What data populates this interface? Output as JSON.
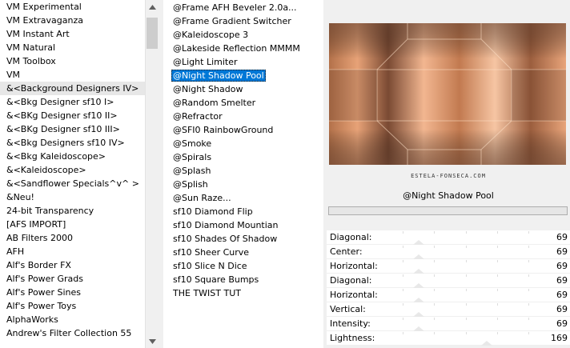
{
  "categories": [
    "VM Experimental",
    "VM Extravaganza",
    "VM Instant Art",
    "VM Natural",
    "VM Toolbox",
    "VM",
    "&<Background Designers IV>",
    "&<Bkg Designer sf10 I>",
    "&<BKg Designer sf10 II>",
    "&<BKg Designer sf10 III>",
    "&<Bkg Designers sf10 IV>",
    "&<Bkg Kaleidoscope>",
    "&<Kaleidoscope>",
    "&<Sandflower Specials^v^ >",
    "&Neu!",
    "24-bit Transparency",
    "[AFS IMPORT]",
    "AB Filters 2000",
    "AFH",
    "Alf's Border FX",
    "Alf's Power Grads",
    "Alf's Power Sines",
    "Alf's Power Toys",
    "AlphaWorks",
    "Andrew's Filter Collection 55"
  ],
  "selected_category_index": 6,
  "filters": [
    "@Frame AFH Beveler 2.0a...",
    "@Frame Gradient Switcher",
    "@Kaleidoscope 3",
    "@Lakeside Reflection MMMM",
    "@Light Limiter",
    "@Night Shadow Pool",
    "@Night Shadow",
    "@Random Smelter",
    "@Refractor",
    "@SFI0 RainbowGround",
    "@Smoke",
    "@Spirals",
    "@Splash",
    "@Splish",
    "@Sun Raze...",
    "sf10 Diamond Flip",
    "sf10 Diamond Mountian",
    "sf10 Shades Of Shadow",
    "sf10 Sheer Curve",
    "sf10 Slice N Dice",
    "sf10 Square Bumps",
    "THE TWIST TUT"
  ],
  "selected_filter_index": 5,
  "preview": {
    "watermark": "ESTELA-FONSECA.COM"
  },
  "current_filter": "@Night Shadow Pool",
  "params": [
    {
      "label": "Diagonal:",
      "value": "69",
      "level": 0.27
    },
    {
      "label": "Center:",
      "value": "69",
      "level": 0.27
    },
    {
      "label": "Horizontal:",
      "value": "69",
      "level": 0.27
    },
    {
      "label": "Diagonal:",
      "value": "69",
      "level": 0.27
    },
    {
      "label": "Horizontal:",
      "value": "69",
      "level": 0.27
    },
    {
      "label": "Vertical:",
      "value": "69",
      "level": 0.27
    },
    {
      "label": "Intensity:",
      "value": "69",
      "level": 0.27
    },
    {
      "label": "Lightness:",
      "value": "169",
      "level": 0.66
    }
  ],
  "colors": {
    "selection": "#0078d7",
    "selected_category_bg": "#e7e7e7"
  },
  "icons": {
    "scroll_up": "triangle-up-icon",
    "scroll_down": "triangle-down-icon"
  }
}
